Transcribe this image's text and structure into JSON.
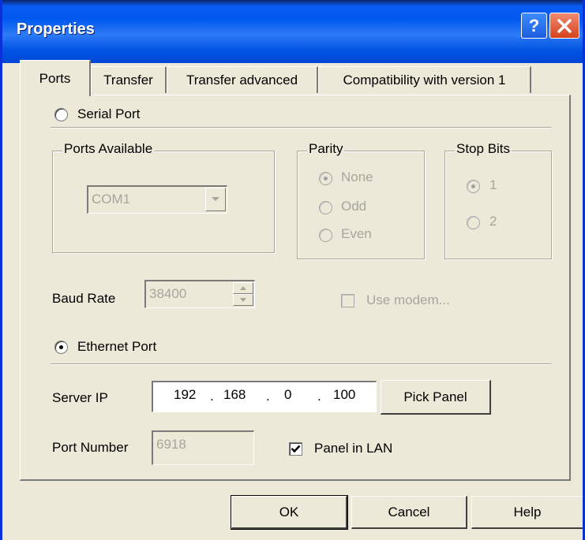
{
  "window": {
    "title": "Properties",
    "help_glyph": "?"
  },
  "tabs": [
    {
      "label": "Ports"
    },
    {
      "label": "Transfer"
    },
    {
      "label": "Transfer advanced"
    },
    {
      "label": "Compatibility with version 1"
    }
  ],
  "serial": {
    "radio_label": "Serial Port",
    "ports_available_title": "Ports Available",
    "port_value": "COM1",
    "parity_title": "Parity",
    "parity_options": [
      "None",
      "Odd",
      "Even"
    ],
    "stopbits_title": "Stop Bits",
    "stopbits_options": [
      "1",
      "2"
    ],
    "baud_label": "Baud Rate",
    "baud_value": "38400",
    "use_modem_label": "Use modem..."
  },
  "ethernet": {
    "radio_label": "Ethernet Port",
    "server_ip_label": "Server IP",
    "ip": [
      "192",
      "168",
      "0",
      "100"
    ],
    "ip_dot": ".",
    "pick_panel_label": "Pick Panel",
    "port_number_label": "Port Number",
    "port_number_value": "6918",
    "panel_in_lan_label": "Panel in LAN"
  },
  "buttons": {
    "ok": "OK",
    "cancel": "Cancel",
    "help": "Help"
  },
  "state": {
    "serial_selected": false,
    "ethernet_selected": true,
    "panel_in_lan_checked": true,
    "use_modem_checked": false,
    "parity_selected": "None",
    "stopbits_selected": "1"
  },
  "colors": {
    "face": "#ECE9D8",
    "title_blue": "#0054E3",
    "disabled_text": "#a7a69c",
    "close_red": "#D5411C"
  },
  "icons": {
    "help": "help-icon",
    "close": "close-icon",
    "dropdown": "chevron-down-icon",
    "spin_up": "spin-up-icon",
    "spin_down": "spin-down-icon",
    "check": "checkmark-icon"
  }
}
